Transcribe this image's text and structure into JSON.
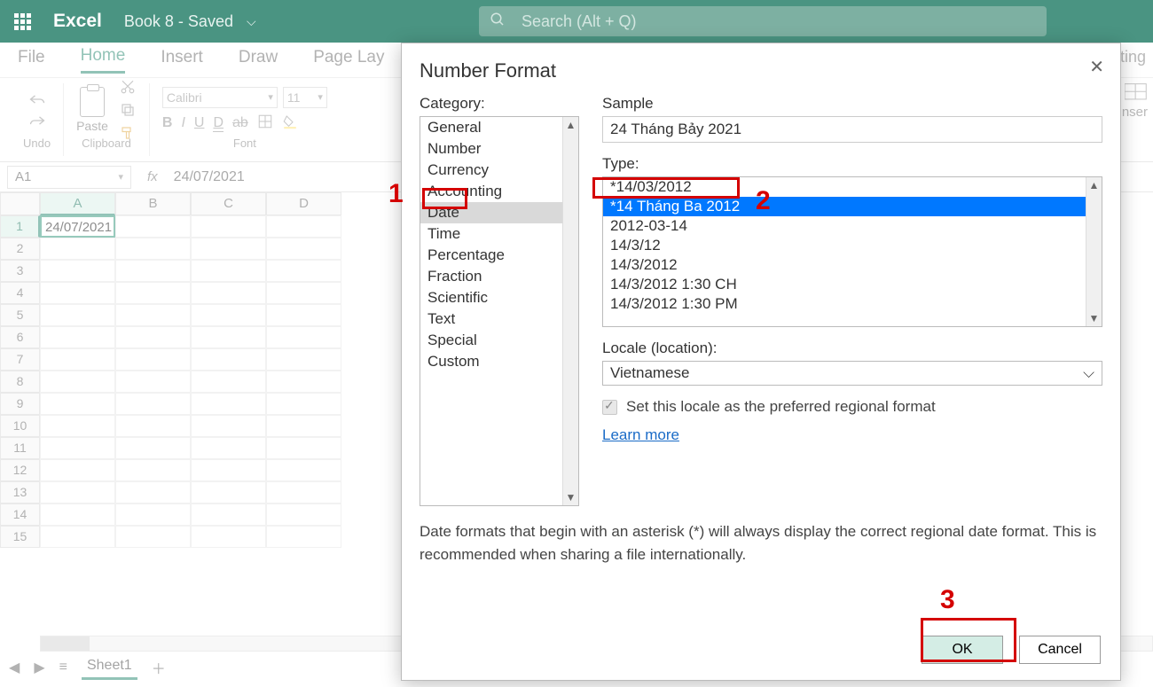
{
  "titlebar": {
    "app": "Excel",
    "doc": "Book 8 - Saved",
    "search_placeholder": "Search (Alt + Q)"
  },
  "tabs": {
    "file": "File",
    "home": "Home",
    "insert": "Insert",
    "draw": "Draw",
    "page_layout": "Page Lay",
    "right_partial": "ting"
  },
  "toolbar": {
    "undo": "Undo",
    "paste": "Paste",
    "clipboard": "Clipboard",
    "font_name": "Calibri",
    "font_size": "11",
    "bold": "B",
    "italic": "I",
    "underline": "U",
    "double_under": "D",
    "strike": "ab",
    "font": "Font",
    "insert_partial": "nser"
  },
  "formula": {
    "name_box": "A1",
    "fx": "fx",
    "content": "24/07/2021"
  },
  "grid": {
    "cols": [
      "A",
      "B",
      "C",
      "D"
    ],
    "rows": [
      "1",
      "2",
      "3",
      "4",
      "5",
      "6",
      "7",
      "8",
      "9",
      "10",
      "11",
      "12",
      "13",
      "14",
      "15"
    ],
    "a1": "24/07/2021"
  },
  "sheet_tabs": {
    "sheet1": "Sheet1"
  },
  "dialog": {
    "title": "Number Format",
    "category_label": "Category:",
    "categories": [
      "General",
      "Number",
      "Currency",
      "Accounting",
      "Date",
      "Time",
      "Percentage",
      "Fraction",
      "Scientific",
      "Text",
      "Special",
      "Custom"
    ],
    "selected_category": "Date",
    "sample_label": "Sample",
    "sample_value": "24 Tháng Bảy 2021",
    "type_label": "Type:",
    "types": [
      "*14/03/2012",
      "*14 Tháng Ba 2012",
      "2012-03-14",
      "14/3/12",
      "14/3/2012",
      "14/3/2012 1:30 CH",
      "14/3/2012 1:30 PM"
    ],
    "selected_type": "*14 Tháng Ba 2012",
    "locale_label": "Locale (location):",
    "locale_value": "Vietnamese",
    "locale_check": "Set this locale as the preferred regional format",
    "learn_more": "Learn more",
    "hint": "Date formats that begin with an asterisk (*) will always display the correct regional date format. This is recommended when sharing a file internationally.",
    "ok": "OK",
    "cancel": "Cancel"
  },
  "annotations": {
    "one": "1",
    "two": "2",
    "three": "3"
  }
}
